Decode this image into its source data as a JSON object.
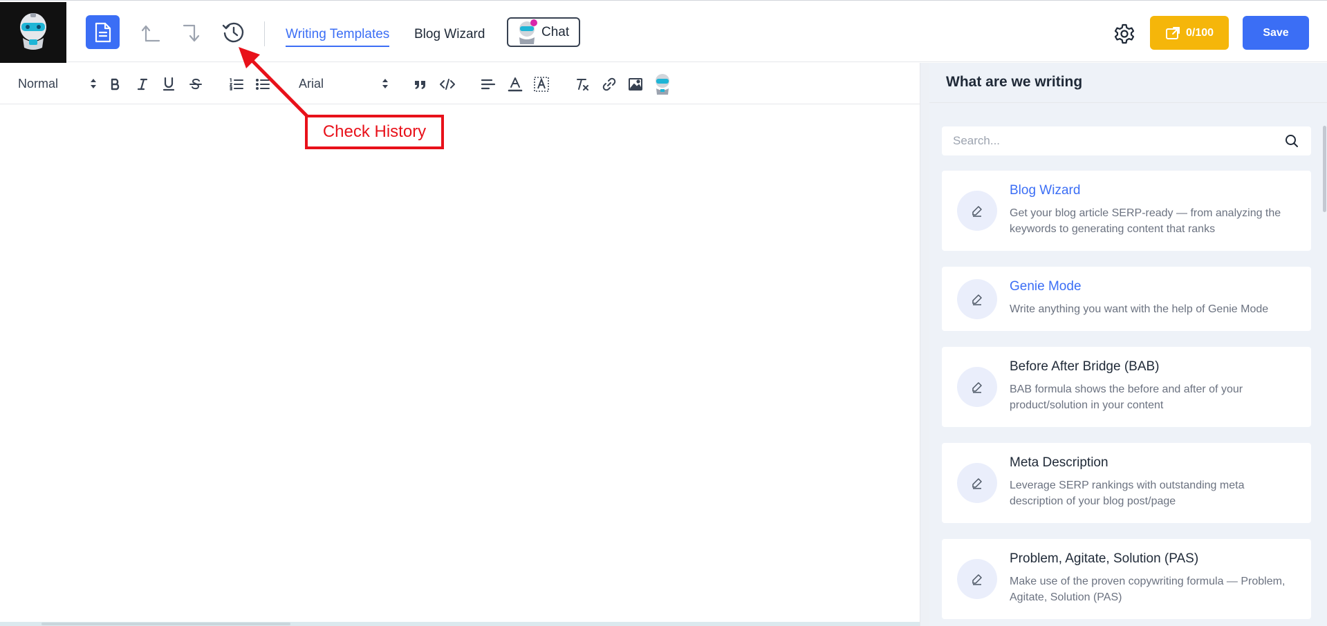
{
  "topbar": {
    "nav": [
      {
        "label": "Writing Templates",
        "active": true
      },
      {
        "label": "Blog Wizard",
        "active": false
      }
    ],
    "chat_label": "Chat",
    "credits_label": "0/100",
    "save_label": "Save"
  },
  "toolbar": {
    "format_value": "Normal",
    "font_value": "Arial"
  },
  "annotation": {
    "label": "Check History"
  },
  "panel": {
    "title": "What are we writing",
    "search_placeholder": "Search...",
    "templates": [
      {
        "title": "Blog Wizard",
        "description": "Get your blog article SERP-ready — from analyzing the keywords to generating content that ranks"
      },
      {
        "title": "Genie Mode",
        "description": "Write anything you want with the help of Genie Mode"
      },
      {
        "title": "Before After Bridge (BAB)",
        "description": "BAB formula shows the before and after of your product/solution in your content"
      },
      {
        "title": "Meta Description",
        "description": "Leverage SERP rankings with outstanding meta description of your blog post/page"
      },
      {
        "title": "Problem, Agitate, Solution (PAS)",
        "description": "Make use of the proven copywriting formula — Problem, Agitate, Solution (PAS)"
      }
    ]
  },
  "colors": {
    "primary": "#3b6ef5",
    "credits": "#f5b60a",
    "annotation": "#e8111a"
  },
  "icons": [
    "robot-logo-icon",
    "document-icon",
    "undo-icon",
    "redo-icon",
    "history-icon",
    "gear-icon",
    "credits-icon",
    "search-icon",
    "edit-icon"
  ]
}
